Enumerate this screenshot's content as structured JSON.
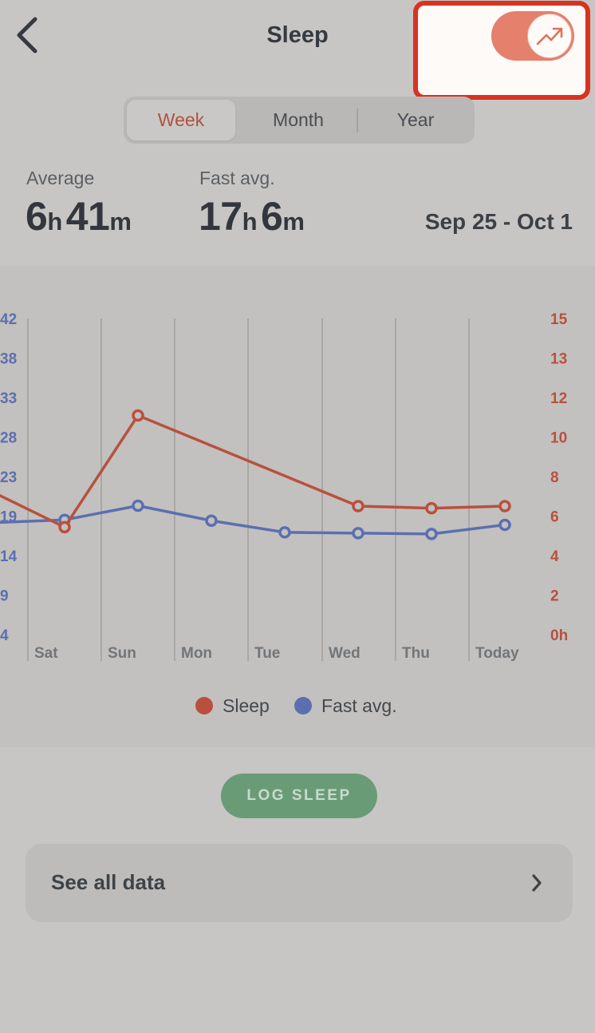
{
  "header": {
    "title": "Sleep",
    "back_icon": "chevron-left-icon",
    "toggle": {
      "on": true,
      "icon": "trend-up-icon",
      "color": "#e4806c"
    },
    "highlight_color": "#d9321f"
  },
  "range_tabs": {
    "items": [
      "Week",
      "Month",
      "Year"
    ],
    "selected": "Week",
    "active_color": "#b0523f"
  },
  "stats": {
    "average": {
      "label": "Average",
      "hours": "6",
      "hours_unit": "h",
      "minutes": "41",
      "minutes_unit": "m"
    },
    "fast_avg": {
      "label": "Fast avg.",
      "hours": "17",
      "hours_unit": "h",
      "minutes": "6",
      "minutes_unit": "m"
    },
    "date_range": "Sep 25 - Oct 1"
  },
  "chart_data": {
    "type": "line",
    "categories": [
      "Sat",
      "Sun",
      "Mon",
      "Tue",
      "Wed",
      "Thu",
      "Today"
    ],
    "left_axis": {
      "ticks": [
        "4",
        "9",
        "14",
        "19",
        "23",
        "28",
        "33",
        "38",
        "42"
      ],
      "range": [
        4,
        42
      ],
      "color": "#5b6fb0"
    },
    "right_axis": {
      "ticks": [
        "0h",
        "2",
        "4",
        "6",
        "8",
        "10",
        "12",
        "13",
        "15"
      ],
      "range": [
        0,
        15
      ],
      "color": "#b9503e"
    },
    "series": [
      {
        "name": "Sleep",
        "axis": "right",
        "color": "#b9503e",
        "values": [
          5.1,
          10.4,
          null,
          null,
          6.1,
          6.0,
          6.1
        ],
        "lead_in": 6.6
      },
      {
        "name": "Fast avg.",
        "axis": "left",
        "color": "#5b6fb0",
        "values": [
          17.8,
          19.5,
          17.7,
          16.3,
          16.2,
          16.1,
          17.2
        ],
        "lead_in": 17.5
      }
    ],
    "grid": true,
    "legend_position": "bottom"
  },
  "actions": {
    "log_button": "LOG SLEEP",
    "log_button_color": "#6a9b77",
    "see_all_label": "See all data",
    "see_all_icon": "chevron-right-icon"
  }
}
